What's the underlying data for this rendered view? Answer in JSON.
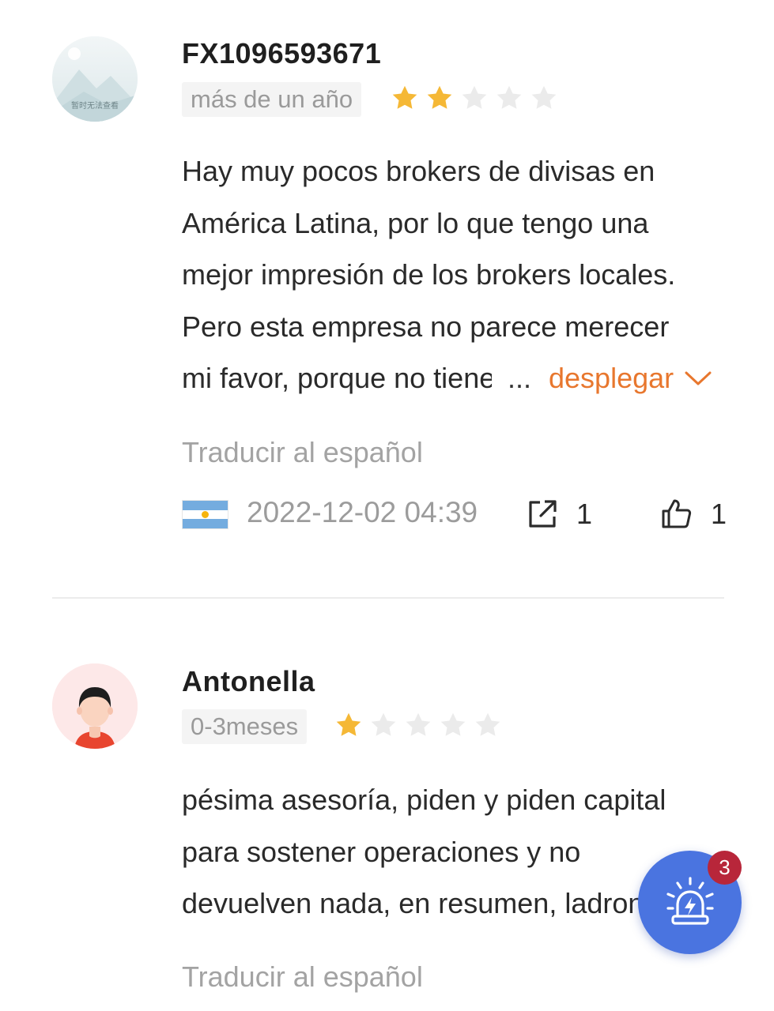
{
  "reviews": [
    {
      "username": "FX1096593671",
      "avatar_icon": "placeholder-image-icon",
      "avatar_caption": "暂时无法查看",
      "duration": "más de un año",
      "rating": 2,
      "rating_max": 5,
      "body_lines": [
        "Hay muy pocos brokers de divisas en",
        "América Latina, por lo que tengo una",
        "mejor impresión de los brokers locales.",
        "Pero esta empresa no parece merecer"
      ],
      "truncated_line": "mi favor, porque no tiene",
      "ellipsis": "...",
      "expand_label": "desplegar",
      "translate_label": "Traducir al español",
      "flag": "argentina-flag",
      "date": "2022-12-02 04:39",
      "share_count": "1",
      "like_count": "1"
    },
    {
      "username": "Antonella",
      "avatar_icon": "user-avatar-icon",
      "duration": "0-3meses",
      "rating": 1,
      "rating_max": 5,
      "body_lines": [
        "pésima asesoría, piden y piden capital",
        "para sostener operaciones y no",
        "devuelven nada, en resumen, ladrones"
      ],
      "translate_label": "Traducir al español"
    }
  ],
  "fab": {
    "icon": "alarm-siren-icon",
    "badge_count": "3"
  },
  "colors": {
    "star_filled": "#f5b836",
    "star_empty": "#ebebeb",
    "accent_orange": "#e8772e",
    "fab_blue": "#4a74e0",
    "badge_red": "#b8263a"
  }
}
